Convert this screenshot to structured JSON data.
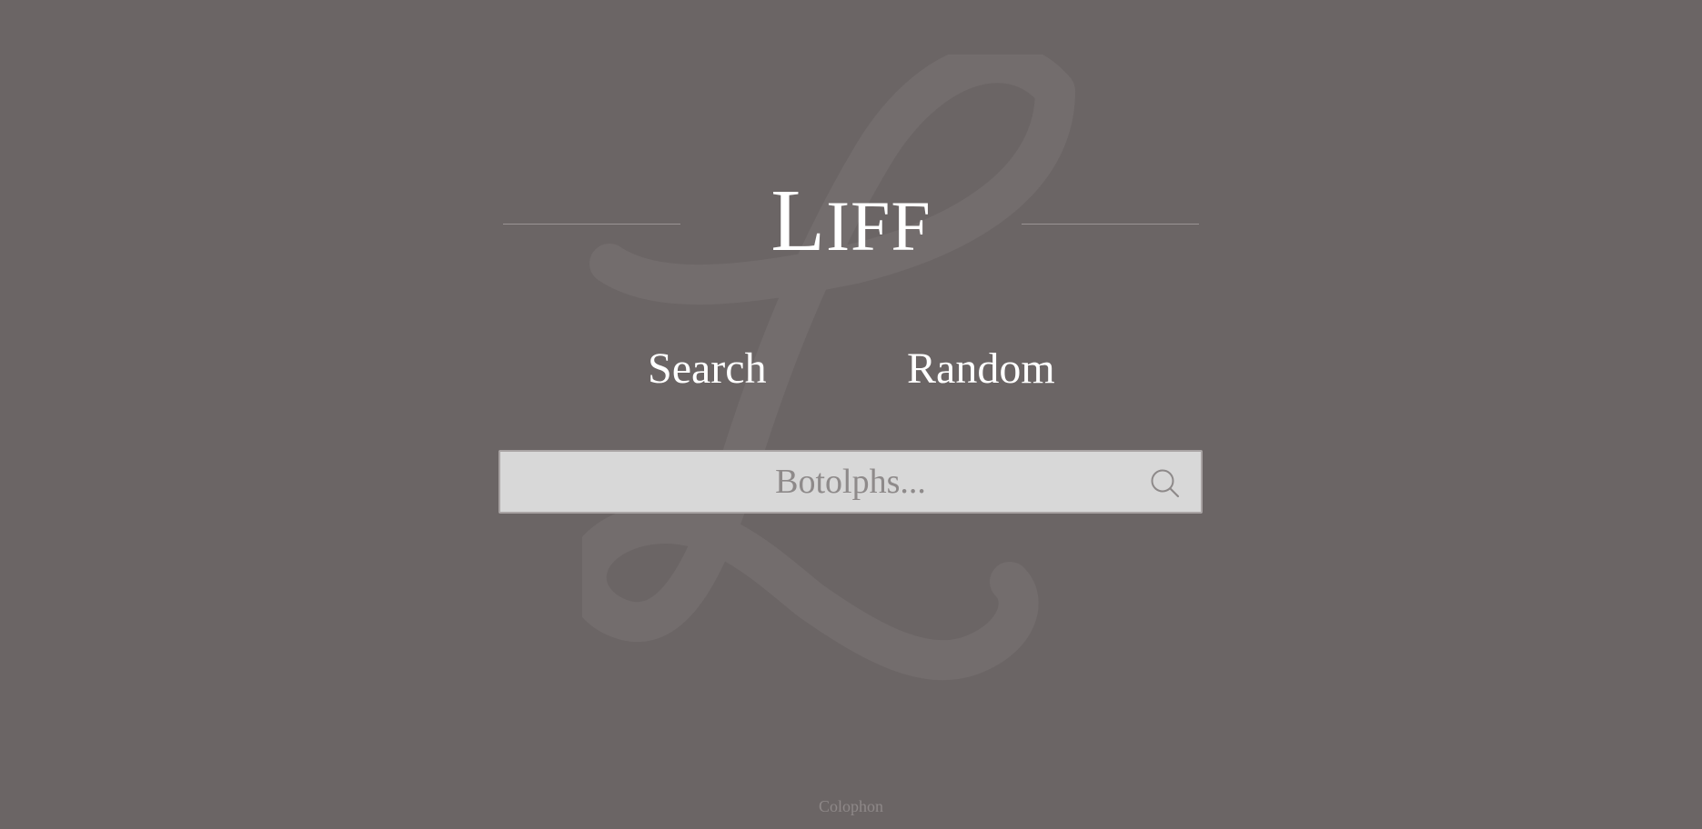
{
  "header": {
    "title_initial": "L",
    "title_rest": "IFF"
  },
  "nav": {
    "search_label": "Search",
    "random_label": "Random"
  },
  "search": {
    "placeholder": "Botolphs...",
    "value": "",
    "icon": "search-icon"
  },
  "footer": {
    "colophon_label": "Colophon"
  },
  "colors": {
    "background": "#6b6565",
    "title_text": "#ffffff",
    "search_field": "#d8d8d8",
    "muted_text": "#8e8888"
  }
}
